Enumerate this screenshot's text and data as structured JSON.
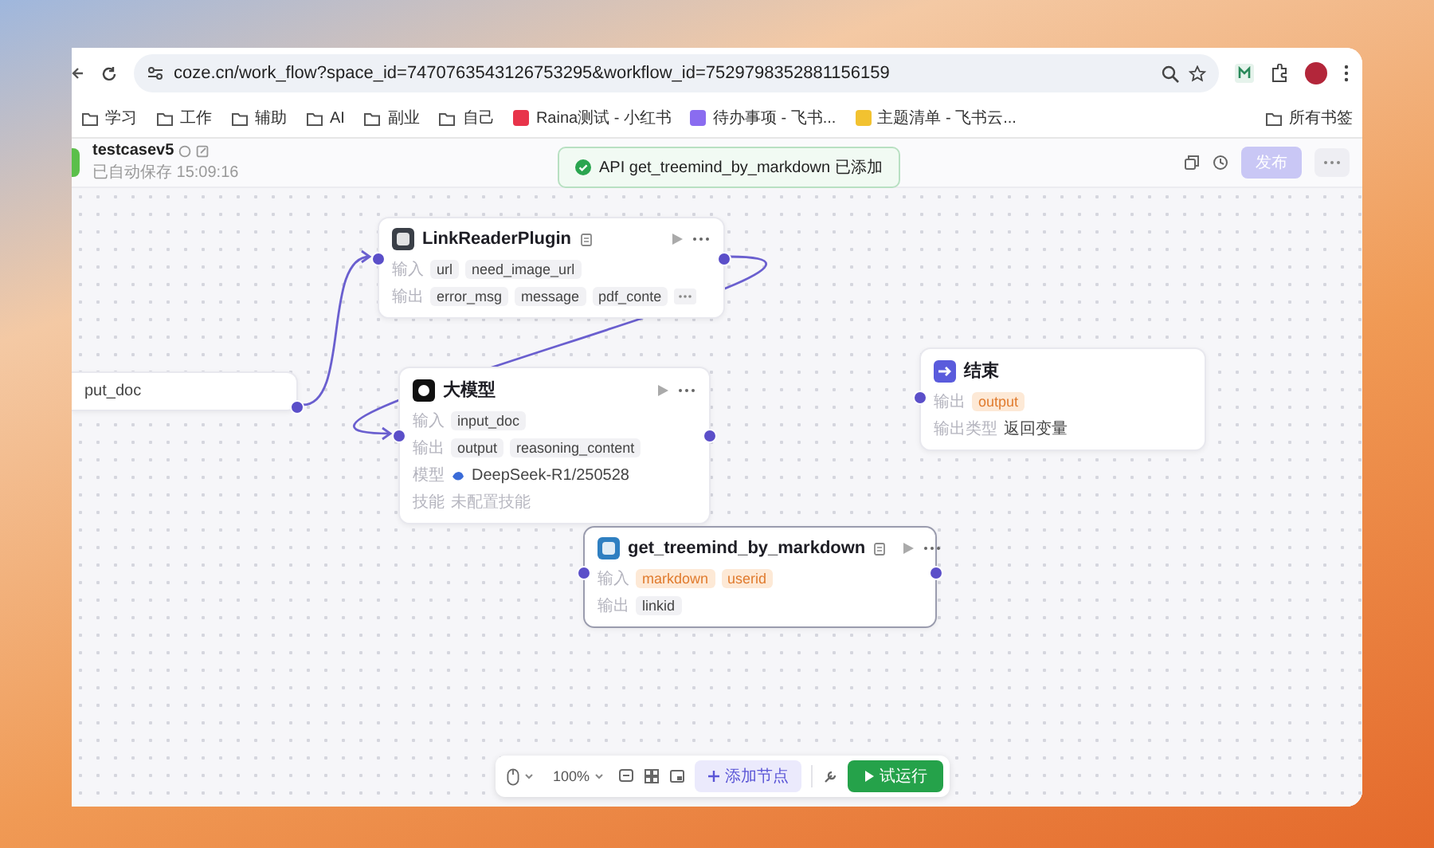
{
  "browser": {
    "url": "coze.cn/work_flow?space_id=7470763543126753295&workflow_id=7529798352881156159",
    "bookmarks": [
      {
        "label": "学习",
        "kind": "folder"
      },
      {
        "label": "工作",
        "kind": "folder"
      },
      {
        "label": "辅助",
        "kind": "folder"
      },
      {
        "label": "AI",
        "kind": "folder"
      },
      {
        "label": "副业",
        "kind": "folder"
      },
      {
        "label": "自己",
        "kind": "folder"
      },
      {
        "label": "Raina测试 - 小红书",
        "kind": "page",
        "color": "#e8344a"
      },
      {
        "label": "待办事项 - 飞书...",
        "kind": "page",
        "color": "#8a6cf0"
      },
      {
        "label": "主题清单 - 飞书云...",
        "kind": "page",
        "color": "#f2c230"
      }
    ],
    "all_bookmarks": "所有书签"
  },
  "header": {
    "title": "testcasev5",
    "saved": "已自动保存 15:09:16",
    "publish": "发布"
  },
  "toast": "API get_treemind_by_markdown 已添加",
  "nodes": [
    {
      "kind": "start",
      "selected": false,
      "has_input": false,
      "has_output": true,
      "rows": [
        {
          "kind": "text",
          "value": "put_doc"
        }
      ]
    },
    {
      "kind": "plugin",
      "title": "LinkReaderPlugin",
      "color": "#3a3f47",
      "selected": false,
      "has_input": true,
      "has_output": true,
      "rows": [
        {
          "kind": "tags",
          "label": "输入",
          "tags": [
            {
              "text": "url",
              "kind": "var"
            },
            {
              "text": "need_image_url",
              "kind": "var"
            }
          ]
        },
        {
          "kind": "tags",
          "label": "输出",
          "overflow": true,
          "tags": [
            {
              "text": "error_msg",
              "kind": "var"
            },
            {
              "text": "message",
              "kind": "var"
            },
            {
              "text": "pdf_conte",
              "kind": "var"
            }
          ]
        }
      ]
    },
    {
      "kind": "llm",
      "title": "大模型",
      "color": "#111111",
      "selected": false,
      "has_input": true,
      "has_output": true,
      "rows": [
        {
          "kind": "tags",
          "label": "输入",
          "tags": [
            {
              "text": "input_doc",
              "kind": "var"
            }
          ]
        },
        {
          "kind": "tags",
          "label": "输出",
          "tags": [
            {
              "text": "output",
              "kind": "var"
            },
            {
              "text": "reasoning_content",
              "kind": "var"
            }
          ]
        },
        {
          "kind": "model",
          "label": "模型",
          "value": "DeepSeek-R1/250528"
        },
        {
          "kind": "muted",
          "label": "技能",
          "placeholder": "未配置技能"
        }
      ]
    },
    {
      "kind": "end",
      "title": "结束",
      "color": "#5a5bdc",
      "selected": false,
      "has_input": true,
      "has_output": false,
      "rows": [
        {
          "kind": "tags",
          "label": "输出",
          "tags": [
            {
              "text": "output",
              "kind": "ref"
            }
          ]
        },
        {
          "kind": "text",
          "label": "输出类型",
          "value": "返回变量"
        }
      ]
    },
    {
      "kind": "plugin",
      "title": "get_treemind_by_markdown",
      "color": "#2f7fc1",
      "selected": true,
      "has_input": true,
      "has_output": true,
      "rows": [
        {
          "kind": "tags",
          "label": "输入",
          "tags": [
            {
              "text": "markdown",
              "kind": "ref"
            },
            {
              "text": "userid",
              "kind": "ref"
            }
          ]
        },
        {
          "kind": "tags",
          "label": "输出",
          "tags": [
            {
              "text": "linkid",
              "kind": "var"
            }
          ]
        }
      ]
    }
  ],
  "toolbar": {
    "zoom": "100%",
    "add_node": "添加节点",
    "run": "试运行"
  }
}
